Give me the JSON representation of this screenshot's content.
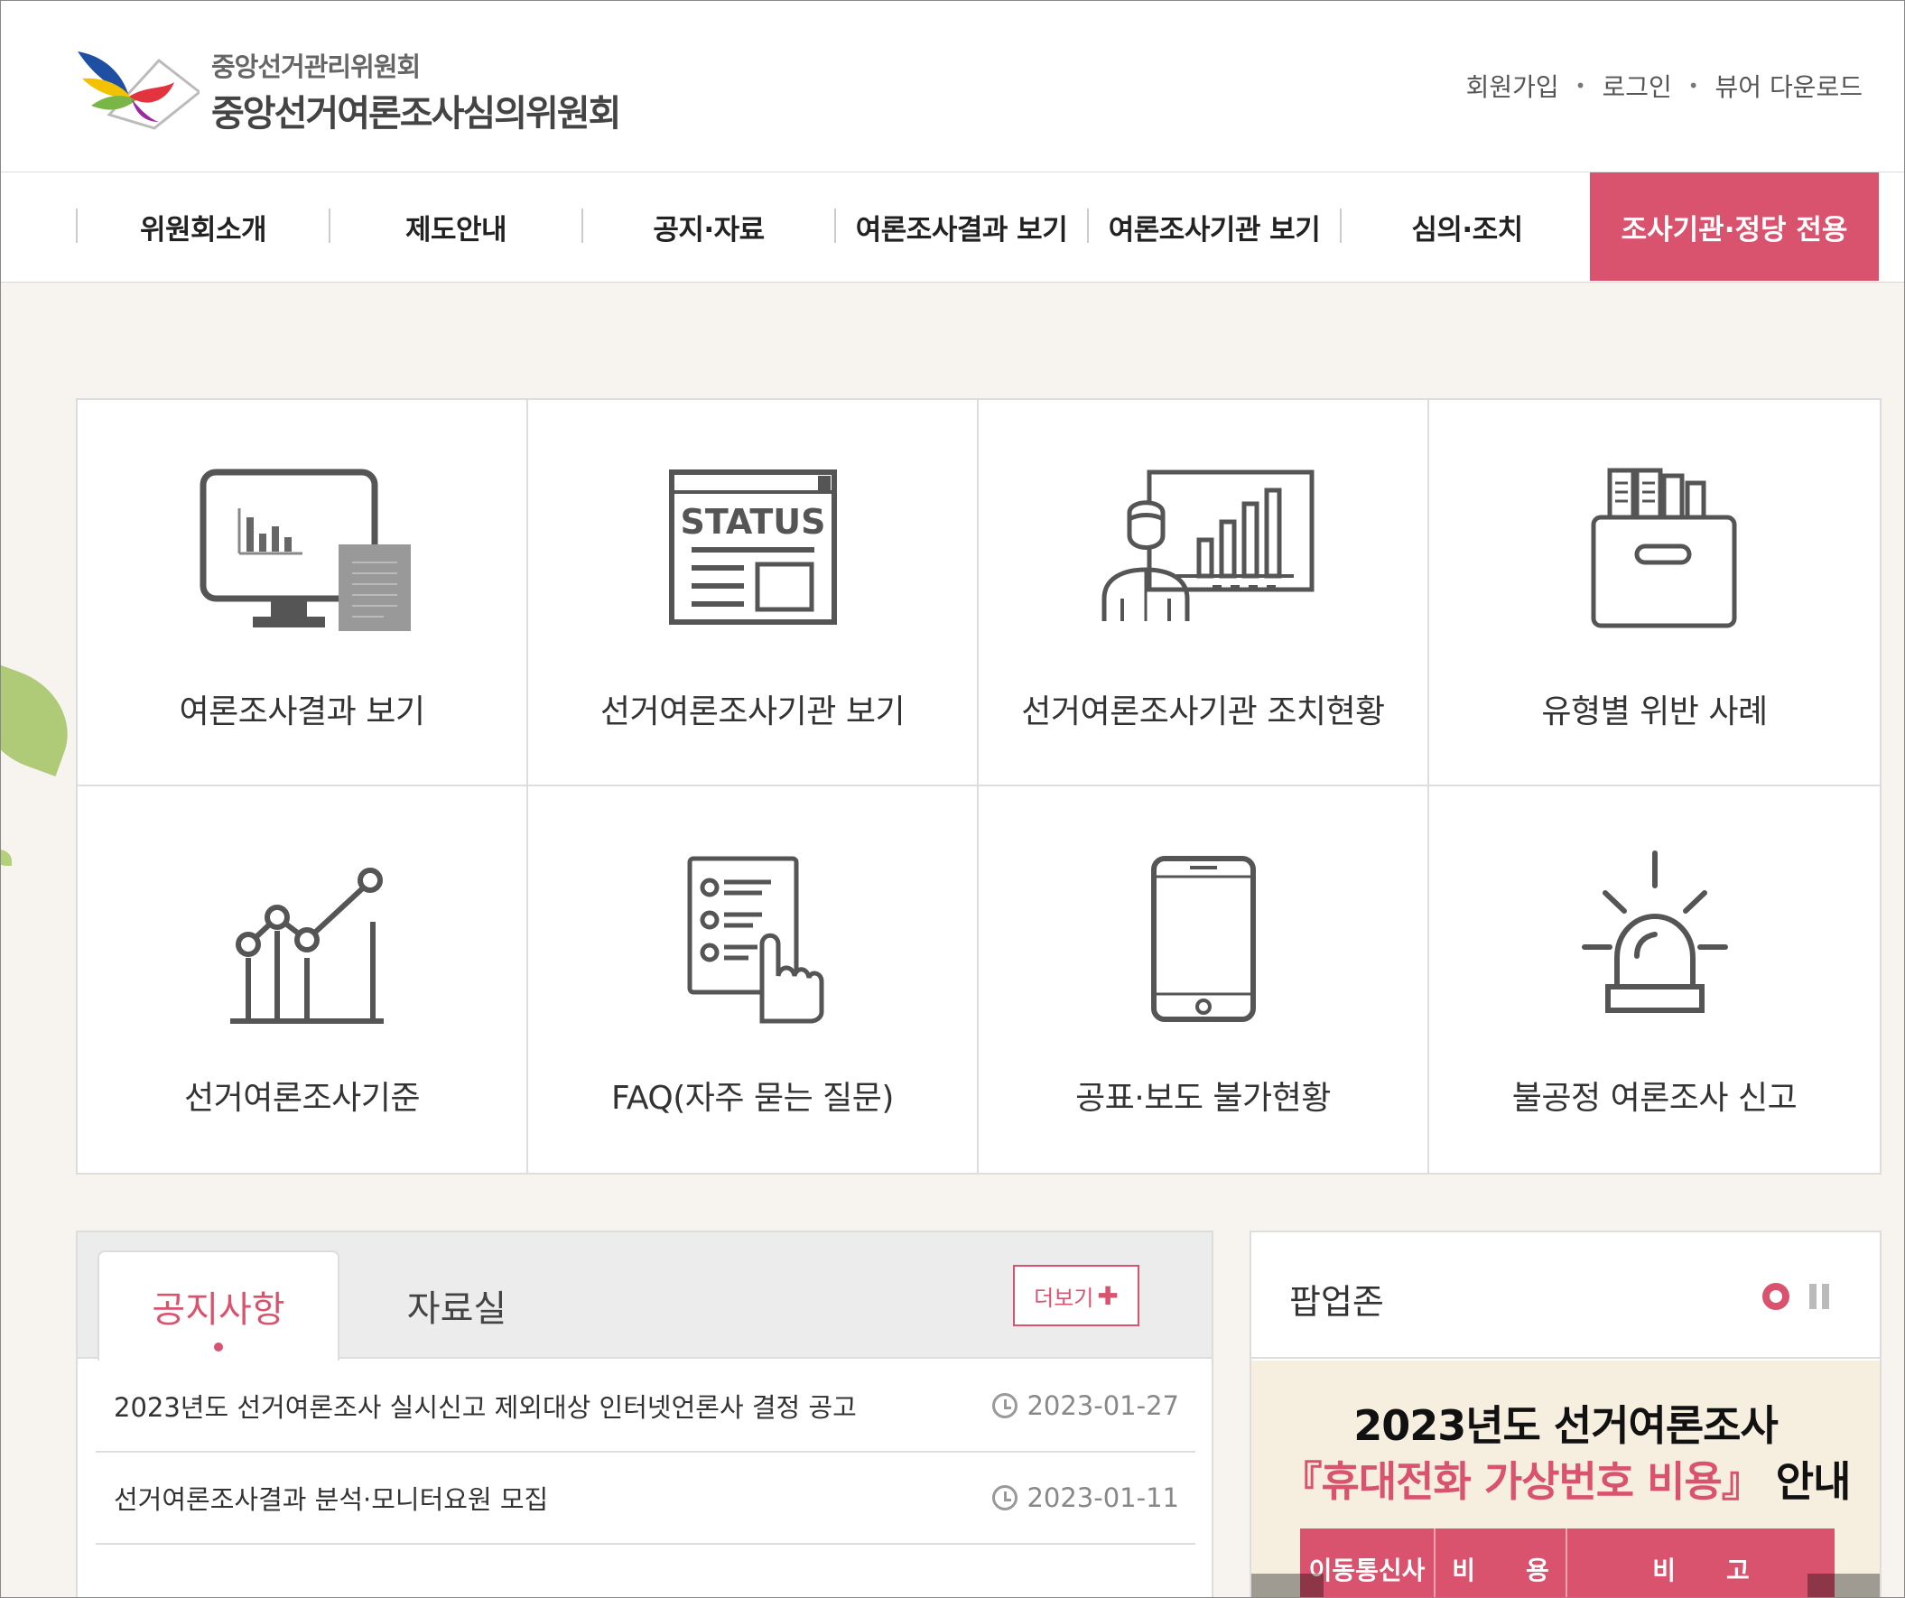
{
  "header": {
    "org_sub": "중앙선거관리위원회",
    "org_main": "중앙선거여론조사심의위원회",
    "util_links": [
      "회원가입",
      "로그인",
      "뷰어 다운로드"
    ]
  },
  "nav": {
    "items": [
      "위원회소개",
      "제도안내",
      "공지·자료",
      "여론조사결과 보기",
      "여론조사기관 보기",
      "심의·조치"
    ],
    "cta": "조사기관·정당 전용",
    "cta_color": "#d9536f"
  },
  "quick_menu": [
    {
      "label": "여론조사결과 보기",
      "icon": "monitor-chart-icon"
    },
    {
      "label": "선거여론조사기관 보기",
      "icon": "status-document-icon"
    },
    {
      "label": "선거여론조사기관 조치현황",
      "icon": "presenter-chart-icon"
    },
    {
      "label": "유형별 위반 사례",
      "icon": "file-box-icon"
    },
    {
      "label": "선거여론조사기준",
      "icon": "line-bar-chart-icon"
    },
    {
      "label": "FAQ(자주 묻는 질문)",
      "icon": "checklist-hand-icon"
    },
    {
      "label": "공표·보도 불가현황",
      "icon": "smartphone-icon"
    },
    {
      "label": "불공정 여론조사 신고",
      "icon": "siren-icon"
    }
  ],
  "notice": {
    "tabs": [
      "공지사항",
      "자료실"
    ],
    "more_label": "더보기",
    "items": [
      {
        "title": "2023년도 선거여론조사 실시신고 제외대상 인터넷언론사 결정 공고",
        "date": "2023-01-27"
      },
      {
        "title": "선거여론조사결과 분석·모니터요원 모집",
        "date": "2023-01-11"
      }
    ]
  },
  "popup": {
    "title": "팝업존",
    "banner_line1": "2023년도 선거여론조사",
    "banner_line2_hl": "『휴대전화 가상번호 비용』",
    "banner_line2_rest": " 안내",
    "table_headers": [
      "이동통신사",
      "비　　용",
      "비　　고"
    ]
  }
}
